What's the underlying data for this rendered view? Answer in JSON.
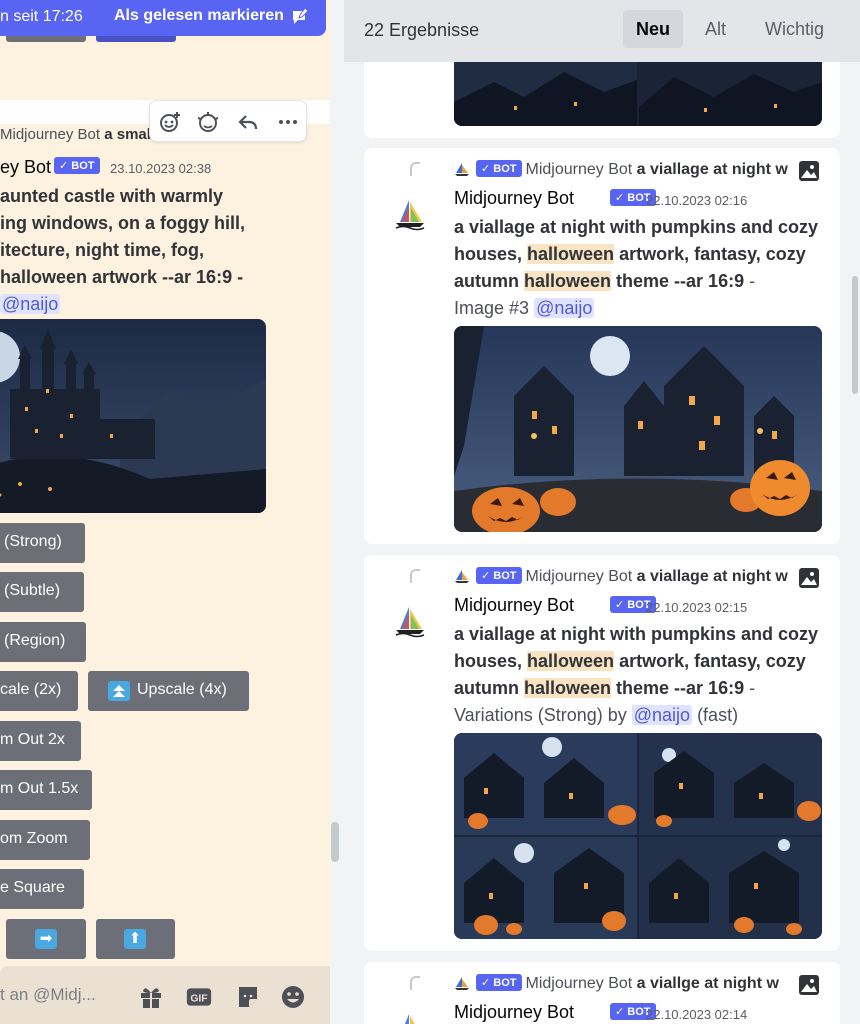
{
  "left": {
    "new_bar": {
      "since": "n seit 17:26",
      "mark_read": "Als gelesen markieren"
    },
    "reply_preview": {
      "author": "Midjourney Bot",
      "text": "a small haunted"
    },
    "message": {
      "author": "ey Bot",
      "badge": "✓ BOT",
      "timestamp": "23.10.2023 02:38",
      "lines": [
        "aunted castle with warmly",
        "ing windows, on a foggy hill,",
        "itecture, night time, fog,",
        "halloween artwork --ar 16:9 -"
      ],
      "mention": "@naijo"
    },
    "buttons": {
      "strong": "(Strong)",
      "subtle": "(Subtle)",
      "region": "(Region)",
      "upscale2": "cale (2x)",
      "upscale4": "Upscale (4x)",
      "zoom2": "m Out 2x",
      "zoom15": "m Out 1.5x",
      "custom_zoom": "om Zoom",
      "square": "e Square",
      "arrow_right": "➡",
      "arrow_up": "⬆"
    },
    "composer": {
      "placeholder": "t an @Midj...",
      "gif": "GIF"
    }
  },
  "right": {
    "result_count": "22 Ergebnisse",
    "tabs": {
      "new": "Neu",
      "old": "Alt",
      "important": "Wichtig"
    },
    "results": [
      {
        "ref_badge": "✓ BOT",
        "ref_author": "Midjourney Bot",
        "ref_text": "a viallage at night w",
        "author": "Midjourney Bot",
        "badge": "✓ BOT",
        "timestamp": "22.10.2023 02:16",
        "p1": "a viallage at night with pumpkins and cozy houses, ",
        "h1": "halloween",
        "p2": " artwork, fantasy, cozy autumn ",
        "h2": "halloween",
        "p3": " theme --ar 16:9",
        "dash": " -",
        "tail": "Image #3 ",
        "mention": "@naijo",
        "suffix": ""
      },
      {
        "ref_badge": "✓ BOT",
        "ref_author": "Midjourney Bot",
        "ref_text": "a viallage at night w",
        "author": "Midjourney Bot",
        "badge": "✓ BOT",
        "timestamp": "22.10.2023 02:15",
        "p1": "a viallage at night with pumpkins and cozy houses, ",
        "h1": "halloween",
        "p2": " artwork, fantasy, cozy autumn ",
        "h2": "halloween",
        "p3": " theme --ar 16:9",
        "dash": " -",
        "tail": "Variations (Strong) by ",
        "mention": "@naijo",
        "suffix": " (fast)"
      },
      {
        "ref_badge": "✓ BOT",
        "ref_author": "Midjourney Bot",
        "ref_text": "a viallge at night w",
        "author": "Midjourney Bot",
        "badge": "✓ BOT",
        "timestamp": "22.10.2023 02:14"
      }
    ]
  },
  "colors": {
    "accent": "#5865f2",
    "highlight": "#f8e4c2",
    "mention_bg": "#e0e3ff",
    "button_gray": "#6d6f78"
  }
}
